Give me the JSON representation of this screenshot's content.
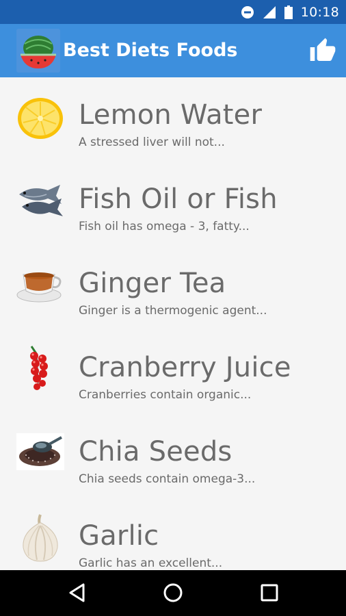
{
  "status_bar": {
    "time": "10:18"
  },
  "app_bar": {
    "title": "Best Diets Foods"
  },
  "items": [
    {
      "title": "Lemon Water",
      "description": "A stressed liver will not...",
      "icon": "lemon-icon"
    },
    {
      "title": "Fish Oil or Fish",
      "description": "Fish oil has omega - 3, fatty...",
      "icon": "fish-icon"
    },
    {
      "title": "Ginger Tea",
      "description": "Ginger is a thermogenic agent...",
      "icon": "tea-cup-icon"
    },
    {
      "title": "Cranberry Juice",
      "description": "Cranberries contain organic...",
      "icon": "cranberry-icon"
    },
    {
      "title": "Chia Seeds",
      "description": "Chia seeds contain omega-3...",
      "icon": "chia-seeds-icon"
    },
    {
      "title": "Garlic",
      "description": "Garlic has an excellent...",
      "icon": "garlic-icon"
    }
  ],
  "colors": {
    "status_bar": "#1c5fae",
    "app_bar": "#3d8fdd",
    "text": "#6a6a6a",
    "background": "#f5f5f5"
  }
}
